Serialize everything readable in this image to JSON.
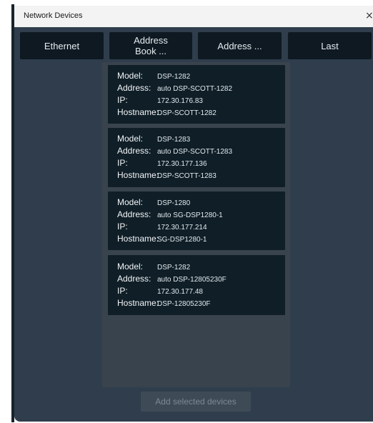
{
  "window": {
    "title": "Network Devices",
    "close_glyph": "×"
  },
  "tabs": [
    {
      "line1": "Ethernet",
      "line2": ""
    },
    {
      "line1": "Address",
      "line2": "Book ..."
    },
    {
      "line1": "Address ...",
      "line2": ""
    },
    {
      "line1": "Last",
      "line2": ""
    }
  ],
  "labels": {
    "model": "Model:",
    "address": "Address:",
    "ip": "IP:",
    "hostname": "Hostname:"
  },
  "devices": [
    {
      "model": "DSP-1282",
      "address": "auto DSP-SCOTT-1282",
      "ip": "172.30.176.83",
      "hostname": "DSP-SCOTT-1282"
    },
    {
      "model": "DSP-1283",
      "address": "auto DSP-SCOTT-1283",
      "ip": "172.30.177.136",
      "hostname": "DSP-SCOTT-1283"
    },
    {
      "model": "DSP-1280",
      "address": "auto SG-DSP1280-1",
      "ip": "172.30.177.214",
      "hostname": "SG-DSP1280-1"
    },
    {
      "model": "DSP-1282",
      "address": "auto DSP-12805230F",
      "ip": "172.30.177.48",
      "hostname": "DSP-12805230F"
    }
  ],
  "footer": {
    "add_button_label": "Add selected devices",
    "add_button_enabled": false
  },
  "colors": {
    "window_bg": "#2f3d4c",
    "tab_bg": "#0e1922",
    "card_bg": "#0f1e27",
    "list_bg": "#39434d",
    "disabled_text": "#7d8892"
  }
}
